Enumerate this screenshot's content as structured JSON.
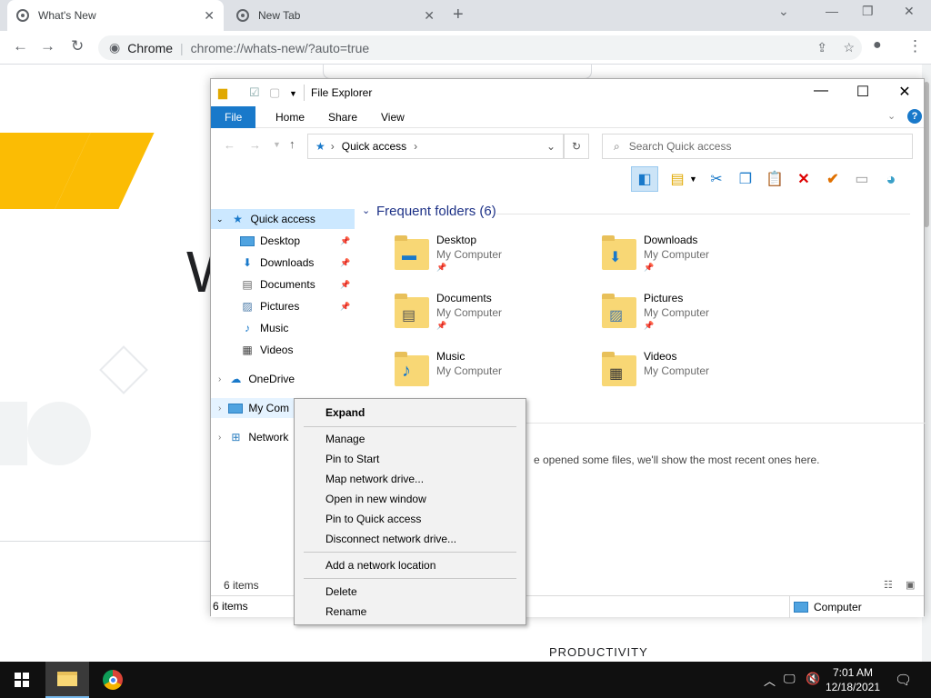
{
  "browser": {
    "tabs": [
      {
        "title": "What's New",
        "active": true
      },
      {
        "title": "New Tab",
        "active": false
      }
    ],
    "omnibox": {
      "site": "Chrome",
      "url": "chrome://whats-new/?auto=true"
    }
  },
  "page": {
    "big_letter": "W",
    "section_label": "PRODUCTIVITY"
  },
  "explorer": {
    "title": "File Explorer",
    "ribbon_tabs": [
      "File",
      "Home",
      "Share",
      "View"
    ],
    "address": {
      "location": "Quick access"
    },
    "search_placeholder": "Search Quick access",
    "nav": {
      "quick_access": "Quick access",
      "pinned": [
        {
          "label": "Desktop",
          "icon": "desktop-icon",
          "pinned": true
        },
        {
          "label": "Downloads",
          "icon": "download-arrow-icon",
          "pinned": true
        },
        {
          "label": "Documents",
          "icon": "document-icon",
          "pinned": true
        },
        {
          "label": "Pictures",
          "icon": "picture-icon",
          "pinned": true
        },
        {
          "label": "Music",
          "icon": "music-note-icon",
          "pinned": false
        },
        {
          "label": "Videos",
          "icon": "film-icon",
          "pinned": false
        }
      ],
      "onedrive": "OneDrive",
      "my_computer": "My Com",
      "network": "Network"
    },
    "frequent_header": "Frequent folders (6)",
    "folders": [
      {
        "name": "Desktop",
        "location": "My Computer",
        "pinned": true
      },
      {
        "name": "Downloads",
        "location": "My Computer",
        "pinned": true
      },
      {
        "name": "Documents",
        "location": "My Computer",
        "pinned": true
      },
      {
        "name": "Pictures",
        "location": "My Computer",
        "pinned": true
      },
      {
        "name": "Music",
        "location": "My Computer",
        "pinned": false
      },
      {
        "name": "Videos",
        "location": "My Computer",
        "pinned": false
      }
    ],
    "recent_text": "e opened some files, we'll show the most recent ones here.",
    "status_items": "6 items",
    "status_items_bottom": "6 items",
    "status_location": "Computer"
  },
  "context_menu": {
    "items": [
      "Expand",
      "Manage",
      "Pin to Start",
      "Map network drive...",
      "Open in new window",
      "Pin to Quick access",
      "Disconnect network drive...",
      "Add a network location",
      "Delete",
      "Rename"
    ]
  },
  "taskbar": {
    "time": "7:01 AM",
    "date": "12/18/2021"
  }
}
